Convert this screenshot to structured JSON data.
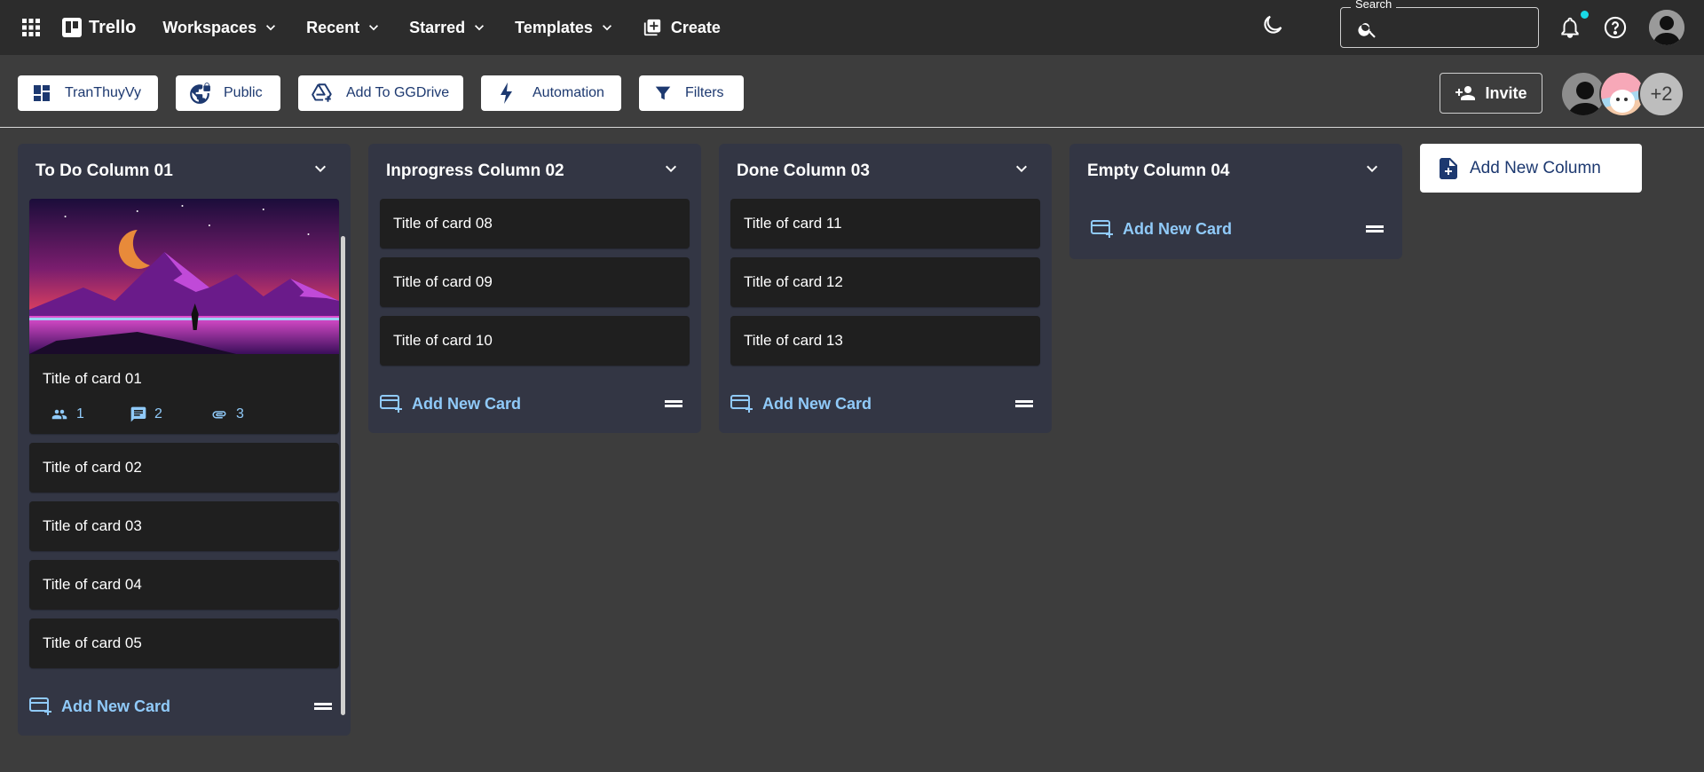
{
  "appbar": {
    "brand": "Trello",
    "nav": [
      {
        "label": "Workspaces"
      },
      {
        "label": "Recent"
      },
      {
        "label": "Starred"
      },
      {
        "label": "Templates"
      }
    ],
    "create_label": "Create",
    "search": {
      "label": "Search",
      "value": ""
    },
    "notification_badge_color": "#19d9e6"
  },
  "boardbar": {
    "chips": [
      {
        "label": "TranThuyVy",
        "icon": "dashboard-icon"
      },
      {
        "label": "Public",
        "icon": "vpn-lock-icon"
      },
      {
        "label": "Add To GGDrive",
        "icon": "add-to-drive-icon"
      },
      {
        "label": "Automation",
        "icon": "bolt-icon"
      },
      {
        "label": "Filters",
        "icon": "filter-icon"
      }
    ],
    "invite_label": "Invite",
    "more_members": "+2"
  },
  "columns": [
    {
      "title": "To Do Column 01",
      "cards": [
        {
          "title": "Title of card 01",
          "has_cover": true,
          "members": "1",
          "comments": "2",
          "attachments": "3"
        },
        {
          "title": "Title of card 02"
        },
        {
          "title": "Title of card 03"
        },
        {
          "title": "Title of card 04"
        },
        {
          "title": "Title of card 05"
        }
      ],
      "add_label": "Add New Card"
    },
    {
      "title": "Inprogress Column 02",
      "cards": [
        {
          "title": "Title of card 08"
        },
        {
          "title": "Title of card 09"
        },
        {
          "title": "Title of card 10"
        }
      ],
      "add_label": "Add New Card"
    },
    {
      "title": "Done Column 03",
      "cards": [
        {
          "title": "Title of card 11"
        },
        {
          "title": "Title of card 12"
        },
        {
          "title": "Title of card 13"
        }
      ],
      "add_label": "Add New Card"
    },
    {
      "title": "Empty Column 04",
      "cards": [],
      "add_label": "Add New Card"
    }
  ],
  "add_column_label": "Add New Column",
  "colors": {
    "appbar_bg": "#2c2c2c",
    "board_bg": "#3d3d3d",
    "column_bg": "#333644",
    "card_bg": "#1f1f1f",
    "accent_link": "#90caf9",
    "chip_text": "#1d3970"
  }
}
